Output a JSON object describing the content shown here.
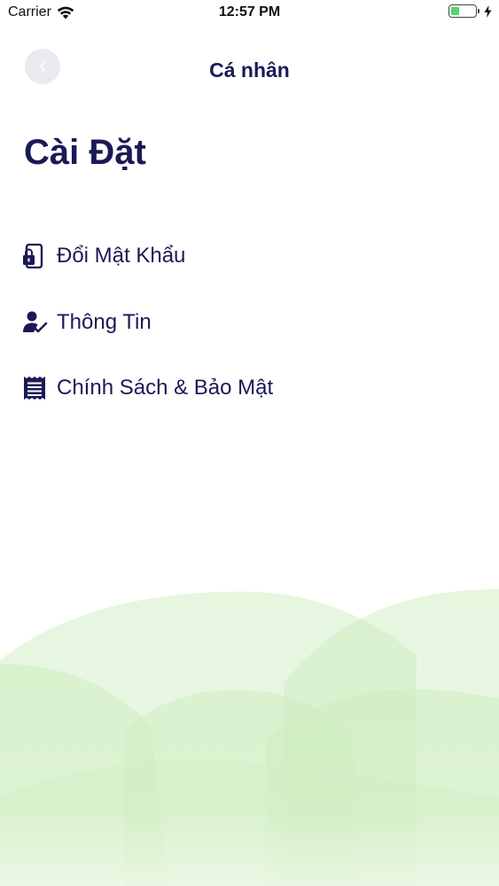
{
  "status_bar": {
    "carrier": "Carrier",
    "time": "12:57 PM",
    "battery_level": 0.35,
    "battery_color": "#4cd964"
  },
  "header": {
    "back_icon": "chevron-left-icon",
    "title": "Cá nhân"
  },
  "page": {
    "title": "Cài Đặt"
  },
  "menu": {
    "items": [
      {
        "icon": "phone-lock-icon",
        "label": "Đổi Mật Khẩu"
      },
      {
        "icon": "user-check-icon",
        "label": "Thông Tin"
      },
      {
        "icon": "receipt-list-icon",
        "label": "Chính Sách & Bảo Mật"
      }
    ]
  },
  "colors": {
    "primary_text": "#1b1a57",
    "back_button_bg": "#e9ebf1",
    "hill_green": "#c8ecb8"
  }
}
